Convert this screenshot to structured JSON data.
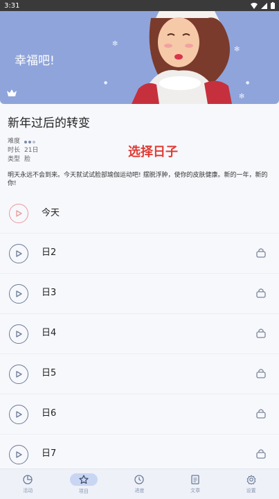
{
  "status": {
    "time": "3:31"
  },
  "banner": {
    "title": "幸福吧!"
  },
  "course": {
    "title": "新年过后的转变",
    "meta": [
      {
        "label": "难度",
        "value": ""
      },
      {
        "label": "时长",
        "value": "21日"
      },
      {
        "label": "类型",
        "value": "脸"
      }
    ],
    "difficulty": 2,
    "difficulty_max": 3,
    "description": "明天永远不会到来。今天就试试脸部瑜伽运动吧! 摆脱浮肿，使你的皮肤健康。新的一年，新的你!"
  },
  "overlay": {
    "choose_day": "选择日子"
  },
  "days": [
    {
      "label": "今天",
      "locked": false,
      "today": true
    },
    {
      "label": "日2",
      "locked": true
    },
    {
      "label": "日3",
      "locked": true
    },
    {
      "label": "日4",
      "locked": true
    },
    {
      "label": "日5",
      "locked": true
    },
    {
      "label": "日6",
      "locked": true
    },
    {
      "label": "日7",
      "locked": true
    }
  ],
  "tabs": [
    {
      "label": "活动",
      "icon": "pie-chart-icon"
    },
    {
      "label": "项目",
      "icon": "star-icon",
      "active": true
    },
    {
      "label": "进度",
      "icon": "clock-icon"
    },
    {
      "label": "文章",
      "icon": "document-icon"
    },
    {
      "label": "设置",
      "icon": "gear-icon"
    }
  ],
  "colors": {
    "banner": "#8fa4da",
    "accent_red": "#e03a33",
    "today_ring": "#e89a9a"
  }
}
